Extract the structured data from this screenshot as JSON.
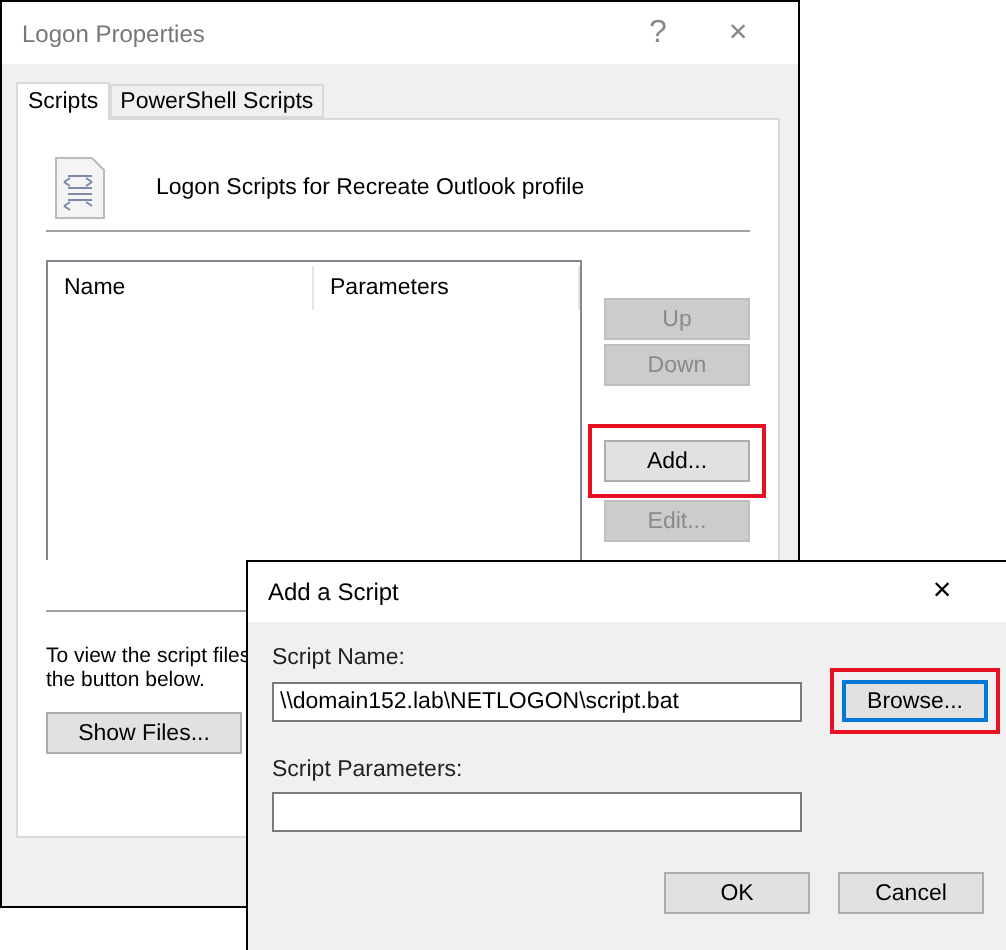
{
  "window": {
    "title": "Logon Properties",
    "help": "?",
    "close": "×"
  },
  "tabs": [
    {
      "label": "Scripts",
      "selected": true
    },
    {
      "label": "PowerShell Scripts",
      "selected": false
    }
  ],
  "heading": "Logon Scripts for Recreate Outlook profile",
  "list": {
    "columns": [
      "Name",
      "Parameters"
    ]
  },
  "side_buttons": [
    {
      "label": "Up",
      "disabled": true,
      "highlighted": false
    },
    {
      "label": "Down",
      "disabled": true,
      "highlighted": false
    },
    {
      "label": "Add...",
      "disabled": false,
      "highlighted": true
    },
    {
      "label": "Edit...",
      "disabled": true,
      "highlighted": false
    }
  ],
  "hint_lines": [
    "To view the script files",
    "the button below."
  ],
  "show_files": "Show Files...",
  "dialog": {
    "title": "Add a Script",
    "close": "×",
    "name_label": "Script Name:",
    "name_value": "\\\\domain152.lab\\NETLOGON\\script.bat",
    "browse": {
      "label": "Browse...",
      "focused": true,
      "highlighted": true
    },
    "params_label": "Script Parameters:",
    "buttons": [
      "OK",
      "Cancel"
    ]
  }
}
